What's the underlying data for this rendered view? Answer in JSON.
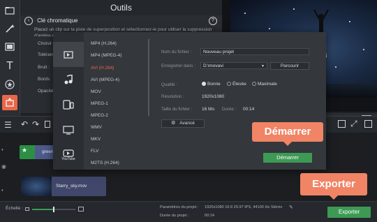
{
  "outils": {
    "title": "Outils",
    "tool_name": "Clé chromatique",
    "description": "Placez un clip sur la piste de superposition et sélectionnez-le pour utiliser la suppression d'arrière-plan.",
    "labels": [
      "Choisir",
      "Tolérance",
      "Bruit :",
      "Bords",
      "Opacité"
    ]
  },
  "export_dialog": {
    "formats": [
      "MP4 (H.264)",
      "MP4 (MPEG-4)",
      "AVI (H.264)",
      "AVI (MPEG-4)",
      "MOV",
      "MPEG-1",
      "MPEG-2",
      "WMV",
      "MKV",
      "FLV",
      "M2TS (H.264)"
    ],
    "selected_format": "AVI (H.264)",
    "side_icons": [
      "video-file-icon",
      "music-note-icon",
      "tablet-icon",
      "tv-icon",
      "youtube-icon"
    ],
    "youtube_label": "YouTube",
    "file_name_label": "Nom du fichier :",
    "file_name_value": "Nouveau projet",
    "save_in_label": "Enregistrer dans :",
    "save_in_value": "D:\\movavi",
    "browse_label": "Parcourir",
    "quality_label": "Qualité :",
    "quality_options": [
      "Bonne",
      "Élevée",
      "Maximale"
    ],
    "quality_selected": "Bonne",
    "resolution_label": "Résolution :",
    "resolution_value": "1920x1080",
    "file_size_label": "Taille du fichier :",
    "file_size_value": "16 Mo",
    "duration_label": "Durée :",
    "duration_value": "00:14",
    "advanced_label": "Avancé",
    "start_button": "Démarrer"
  },
  "callouts": {
    "start": "Démarrer",
    "export": "Exporter"
  },
  "timeline": {
    "clips": [
      {
        "label": "green",
        "track": "overlay"
      },
      {
        "label": "Starry_sky.mov",
        "track": "video"
      }
    ]
  },
  "statusbar": {
    "zoom_label": "Échelle :",
    "project_params_label": "Paramètres du projet :",
    "project_params_value": "1920x1080 16:9 29.97 IPS, 44100 Hz Stéréo",
    "project_duration_label": "Durée du projet :",
    "project_duration_value": "00:14",
    "zoom_level": 0.5,
    "export_button": "Exporter"
  },
  "colors": {
    "accent_orange": "#e8674a",
    "callout_orange": "#f08465",
    "export_green": "#3c9a55"
  }
}
